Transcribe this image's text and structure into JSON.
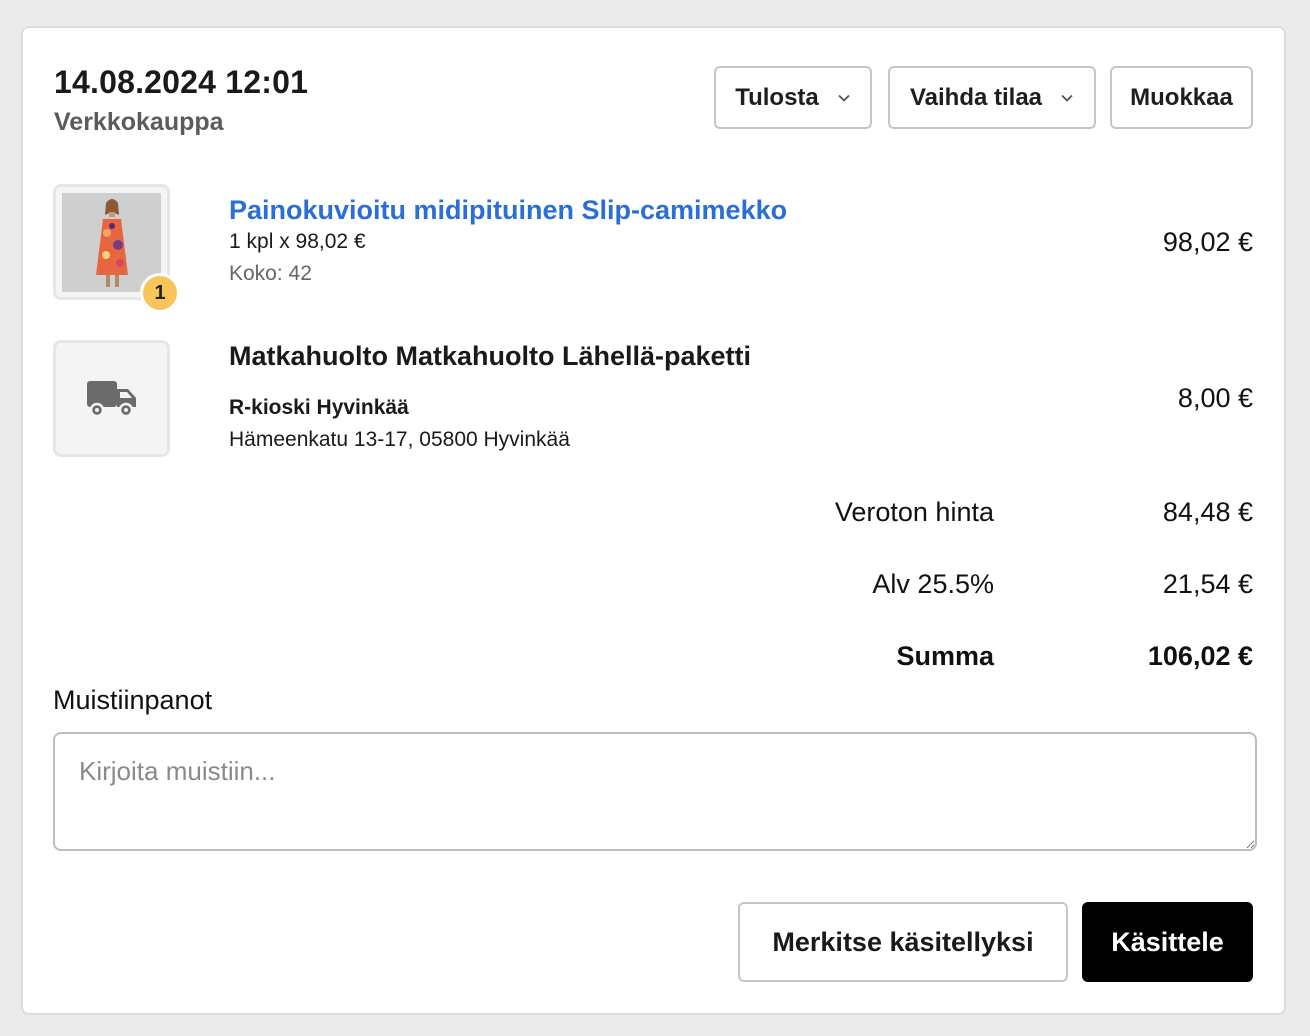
{
  "order": {
    "date": "14.08.2024 12:01",
    "channel": "Verkkokauppa"
  },
  "toolbar": {
    "print_label": "Tulosta",
    "change_status_label": "Vaihda tilaa",
    "edit_label": "Muokkaa"
  },
  "line_item": {
    "image_icon": "dress-photo",
    "quantity_badge": "1",
    "name": "Painokuvioitu midipituinen Slip-camimekko",
    "qty_price": "1 kpl x 98,02 €",
    "size": "Koko: 42",
    "total": "98,02 €"
  },
  "shipping": {
    "icon": "truck-icon",
    "method": "Matkahuolto Matkahuolto Lähellä-paketti",
    "pickup_point": "R-kioski Hyvinkää",
    "address": "Hämeenkatu 13-17, 05800 Hyvinkää",
    "price": "8,00 €"
  },
  "totals": {
    "net_label": "Veroton hinta",
    "net_value": "84,48 €",
    "vat_label": "Alv 25.5%",
    "vat_value": "21,54 €",
    "sum_label": "Summa",
    "sum_value": "106,02 €"
  },
  "notes": {
    "label": "Muistiinpanot",
    "placeholder": "Kirjoita muistiin...",
    "value": ""
  },
  "actions": {
    "mark_processed_label": "Merkitse käsitellyksi",
    "process_label": "Käsittele"
  },
  "colors": {
    "link": "#2a6fd6",
    "badge": "#f7c55a",
    "primary_button": "#000000"
  }
}
